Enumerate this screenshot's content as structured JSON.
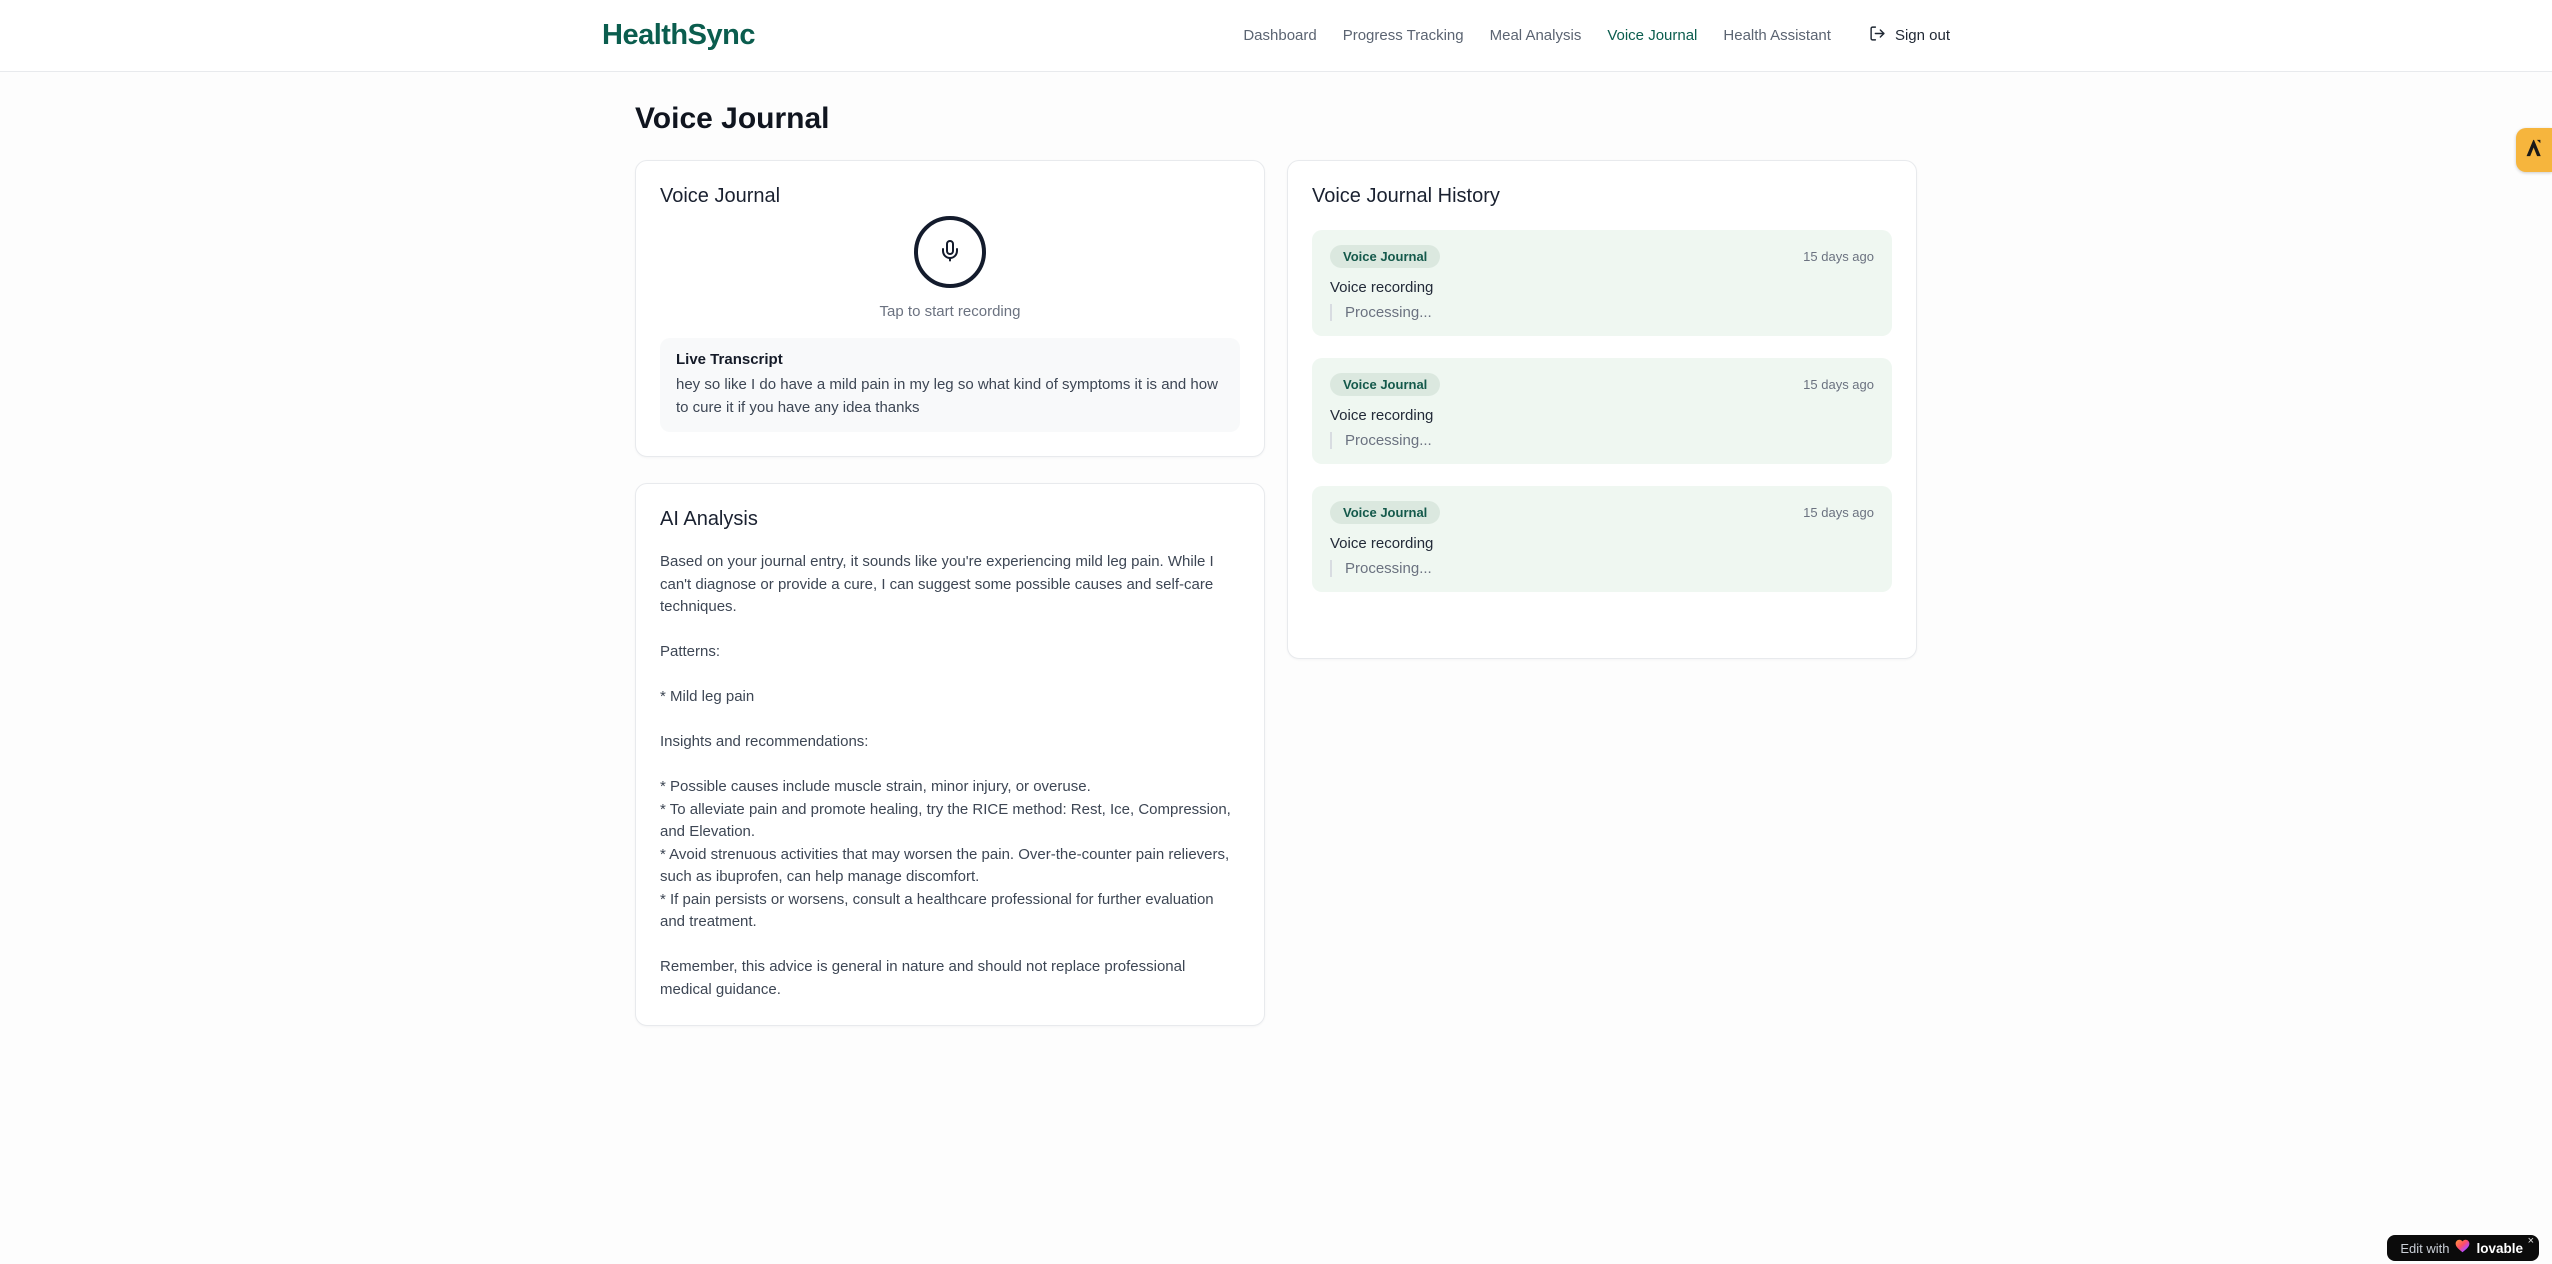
{
  "brand": {
    "name": "HealthSync"
  },
  "nav": {
    "items": [
      {
        "label": "Dashboard"
      },
      {
        "label": "Progress Tracking"
      },
      {
        "label": "Meal Analysis"
      },
      {
        "label": "Voice Journal"
      },
      {
        "label": "Health Assistant"
      }
    ],
    "sign_out_label": "Sign out"
  },
  "page": {
    "title": "Voice Journal"
  },
  "recorder": {
    "card_title": "Voice Journal",
    "tap_hint": "Tap to start recording",
    "transcript_label": "Live Transcript",
    "transcript_text": "hey so like I do have a mild pain in my leg so what kind of symptoms it is and how to cure it if you have any idea thanks"
  },
  "analysis": {
    "card_title": "AI Analysis",
    "body": "Based on your journal entry, it sounds like you're experiencing mild leg pain. While I can't diagnose or provide a cure, I can suggest some possible causes and self-care techniques.\n\nPatterns:\n\n* Mild leg pain\n\nInsights and recommendations:\n\n* Possible causes include muscle strain, minor injury, or overuse.\n* To alleviate pain and promote healing, try the RICE method: Rest, Ice, Compression, and Elevation.\n* Avoid strenuous activities that may worsen the pain. Over-the-counter pain relievers, such as ibuprofen, can help manage discomfort.\n* If pain persists or worsens, consult a healthcare professional for further evaluation and treatment.\n\nRemember, this advice is general in nature and should not replace professional medical guidance."
  },
  "history": {
    "card_title": "Voice Journal History",
    "entries": [
      {
        "badge": "Voice Journal",
        "time": "15 days ago",
        "title": "Voice recording",
        "status": "Processing..."
      },
      {
        "badge": "Voice Journal",
        "time": "15 days ago",
        "title": "Voice recording",
        "status": "Processing..."
      },
      {
        "badge": "Voice Journal",
        "time": "15 days ago",
        "title": "Voice recording",
        "status": "Processing..."
      }
    ]
  },
  "overlays": {
    "edit_with_label": "Edit with",
    "lovable_label": "lovable",
    "close_label": "×"
  },
  "colors": {
    "brand_green": "#0b5d4e",
    "nav_inactive": "#5b6472",
    "badge_bg": "#dbe8df",
    "badge_text": "#14594b",
    "entry_bg": "#eff7f1",
    "mic_ring": "#131b2c",
    "amber_badge": "#f6b53d",
    "overlay_pill_bg": "#0b0b0b"
  }
}
